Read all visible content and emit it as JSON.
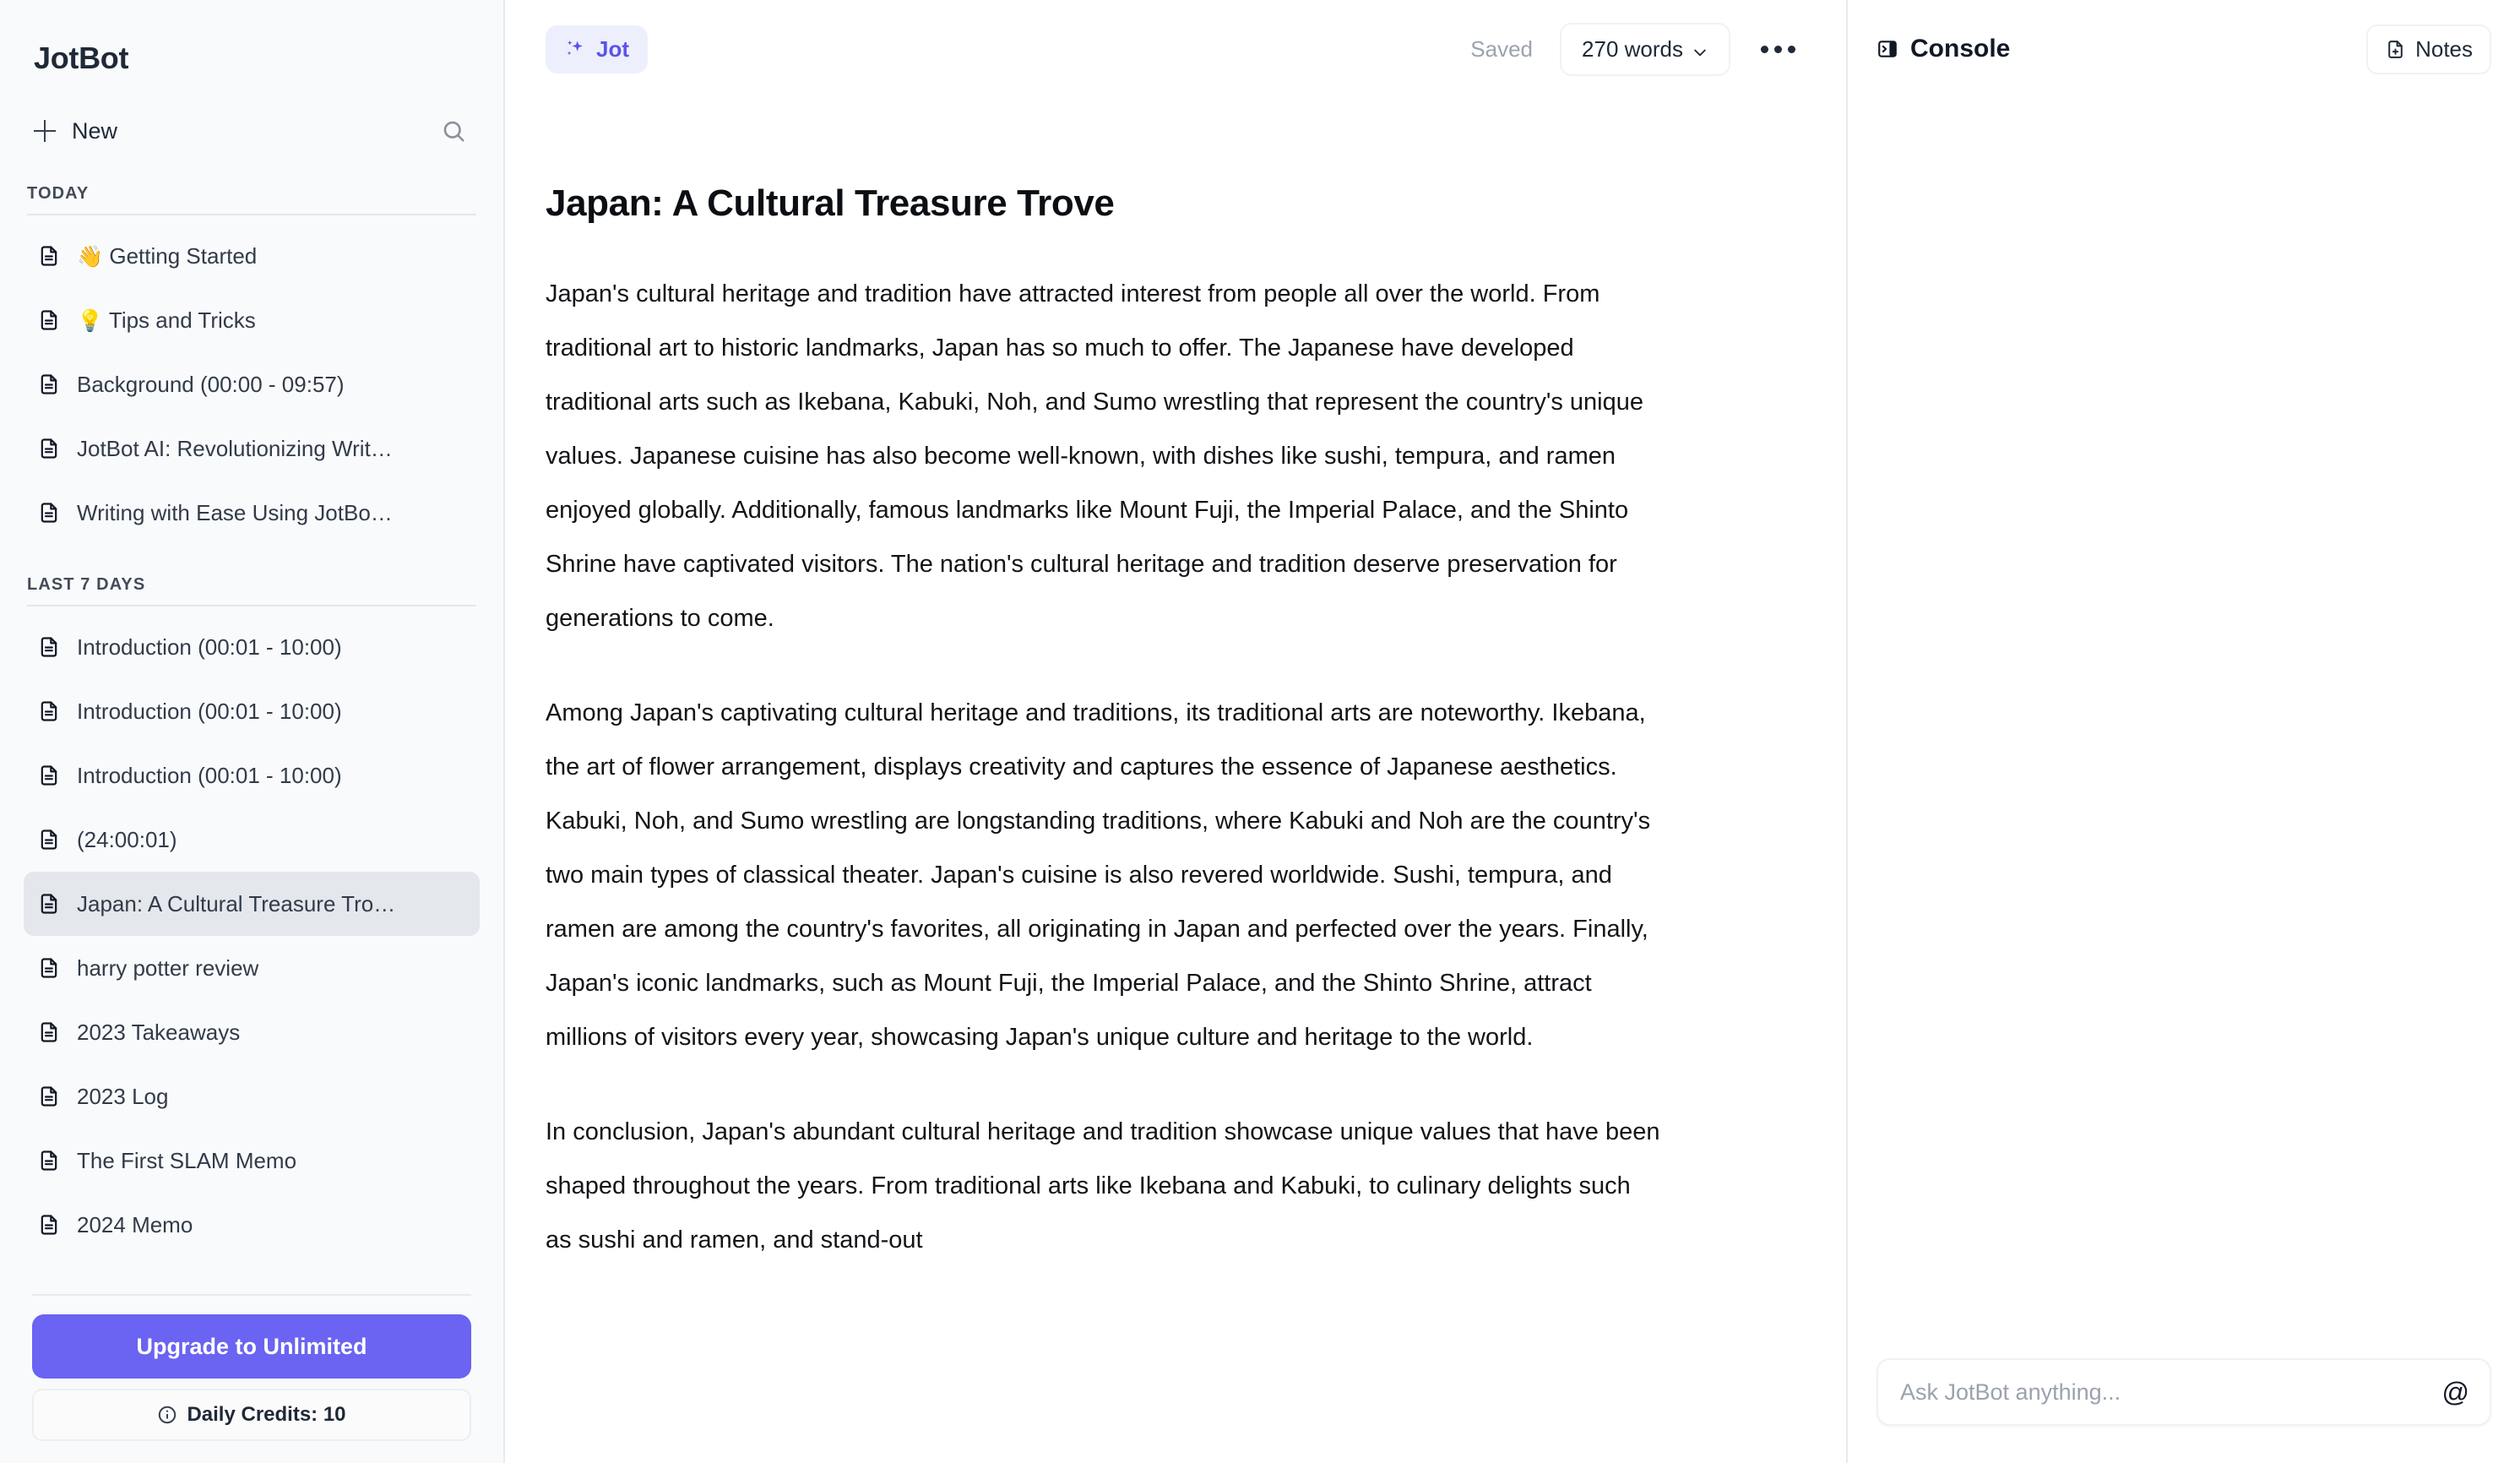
{
  "app": {
    "brand": "JotBot"
  },
  "sidebar": {
    "new_label": "New",
    "search_icon": "search-icon",
    "sections": [
      {
        "label": "TODAY",
        "items": [
          {
            "emoji": "👋",
            "title": "Getting Started",
            "active": false
          },
          {
            "emoji": "💡",
            "title": "Tips and Tricks",
            "active": false
          },
          {
            "emoji": "",
            "title": "Background (00:00 - 09:57)",
            "active": false
          },
          {
            "emoji": "",
            "title": "JotBot AI: Revolutionizing Writ…",
            "active": false
          },
          {
            "emoji": "",
            "title": "Writing with Ease Using JotBo…",
            "active": false
          }
        ]
      },
      {
        "label": "LAST 7 DAYS",
        "items": [
          {
            "emoji": "",
            "title": "Introduction (00:01 - 10:00)",
            "active": false
          },
          {
            "emoji": "",
            "title": "Introduction (00:01 - 10:00)",
            "active": false
          },
          {
            "emoji": "",
            "title": "Introduction (00:01 - 10:00)",
            "active": false
          },
          {
            "emoji": "",
            "title": "(24:00:01)",
            "active": false
          },
          {
            "emoji": "",
            "title": "Japan: A Cultural Treasure Tro…",
            "active": true
          },
          {
            "emoji": "",
            "title": "harry potter review",
            "active": false
          },
          {
            "emoji": "",
            "title": "2023 Takeaways",
            "active": false
          },
          {
            "emoji": "",
            "title": "2023 Log",
            "active": false
          },
          {
            "emoji": "",
            "title": "The First SLAM Memo",
            "active": false
          },
          {
            "emoji": "",
            "title": "2024 Memo",
            "active": false
          }
        ]
      }
    ],
    "upgrade_label": "Upgrade to Unlimited",
    "credits_label": "Daily Credits: 10",
    "accent_color": "#6b63f2"
  },
  "toolbar": {
    "jot_label": "Jot",
    "saved_label": "Saved",
    "word_count_label": "270 words",
    "more_label": "•••"
  },
  "document": {
    "title": "Japan: A Cultural Treasure Trove",
    "paragraphs": [
      "Japan's cultural heritage and tradition have attracted interest from people all over the world. From traditional art to historic landmarks, Japan has so much to offer. The Japanese have developed traditional arts such as Ikebana, Kabuki, Noh, and Sumo wrestling that represent the country's unique values. Japanese cuisine has also become well-known, with dishes like sushi, tempura, and ramen enjoyed globally. Additionally, famous landmarks like Mount Fuji, the Imperial Palace, and the Shinto Shrine have captivated visitors. The nation's cultural heritage and tradition deserve preservation for generations to come.",
      "Among Japan's captivating cultural heritage and traditions, its traditional arts are noteworthy. Ikebana, the art of flower arrangement, displays creativity and captures the essence of Japanese aesthetics. Kabuki, Noh, and Sumo wrestling are longstanding traditions, where Kabuki and Noh are the country's two main types of classical theater. Japan's cuisine is also revered worldwide. Sushi, tempura, and ramen are among the country's favorites, all originating in Japan and perfected over the years. Finally, Japan's iconic landmarks, such as Mount Fuji, the Imperial Palace, and the Shinto Shrine, attract millions of visitors every year, showcasing Japan's unique culture and heritage to the world.",
      "In conclusion, Japan's abundant cultural heritage and tradition showcase unique values that have been shaped throughout the years. From traditional arts like Ikebana and Kabuki, to culinary delights such as sushi and ramen, and stand-out"
    ]
  },
  "console": {
    "title": "Console",
    "notes_label": "Notes",
    "ask_placeholder": "Ask JotBot anything...",
    "at_label": "@"
  }
}
